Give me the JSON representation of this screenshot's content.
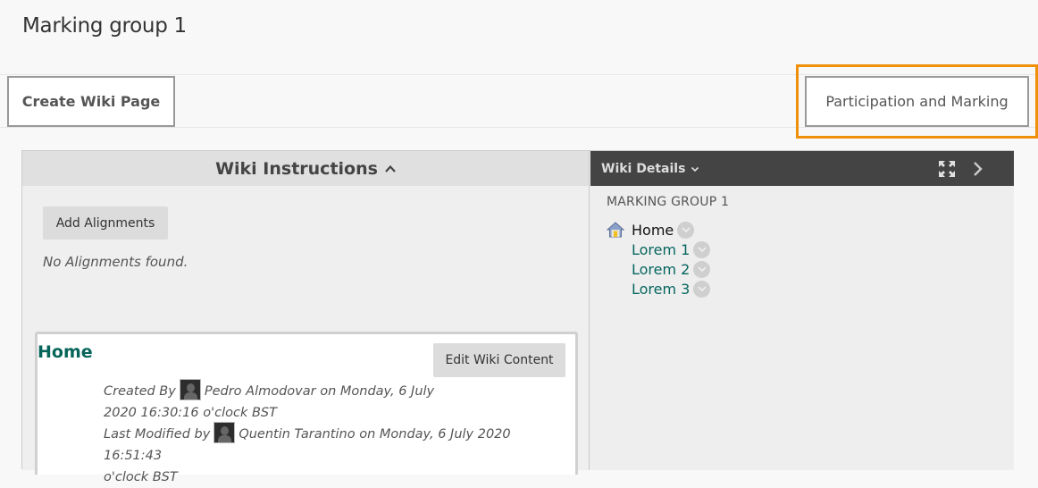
{
  "header": {
    "title": "Marking group 1"
  },
  "toolbar": {
    "create_wiki_page": "Create Wiki Page",
    "participation_and_marking": "Participation and Marking",
    "highlight_color": "#f0900a"
  },
  "instructions": {
    "title": "Wiki Instructions",
    "add_alignments": "Add Alignments",
    "no_alignments": "No Alignments found."
  },
  "page": {
    "title": "Home",
    "edit_button": "Edit Wiki Content",
    "created_by_label": "Created By",
    "created_by_text": "Pedro Almodovar on Monday, 6 July",
    "created_by_text2": "2020 16:30:16 o'clock BST",
    "modified_by_label": "Last Modified by",
    "modified_by_text": "Quentin Tarantino on Monday, 6 July 2020 16:51:43",
    "modified_by_text2": "o'clock BST"
  },
  "details": {
    "title": "Wiki Details",
    "group_label": "MARKING GROUP 1",
    "tree": [
      {
        "label": "Home",
        "icon": "home-icon"
      },
      {
        "label": "Lorem 1"
      },
      {
        "label": "Lorem 2"
      },
      {
        "label": "Lorem 3"
      }
    ]
  }
}
